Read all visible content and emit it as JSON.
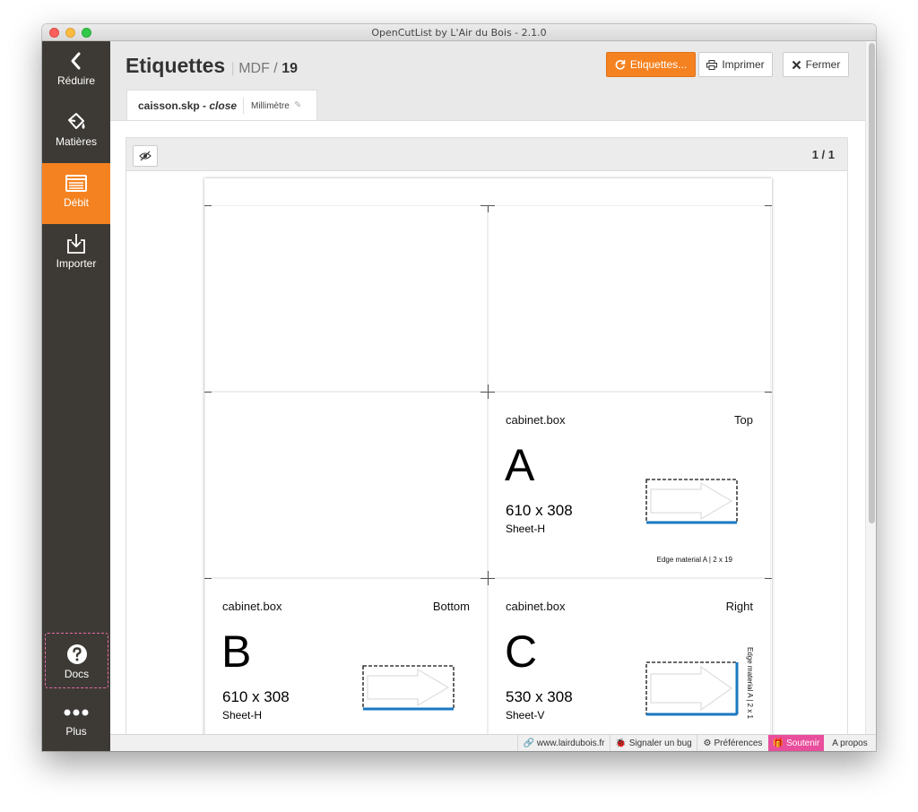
{
  "window": {
    "title": "OpenCutList by L'Air du Bois - 2.1.0"
  },
  "sidebar": {
    "items": [
      {
        "label": "Réduire",
        "icon": "chevron-left-icon"
      },
      {
        "label": "Matières",
        "icon": "paint-bucket-icon"
      },
      {
        "label": "Débit",
        "icon": "list-icon",
        "active": true
      },
      {
        "label": "Importer",
        "icon": "import-icon"
      }
    ],
    "docs": {
      "label": "Docs",
      "icon": "question-circle-icon"
    },
    "plus": {
      "label": "Plus",
      "icon": "ellipsis-icon"
    },
    "colors": {
      "background": "#3d3a35",
      "active": "#f58220"
    }
  },
  "header": {
    "title": "Etiquettes",
    "material": "MDF",
    "slash": "/",
    "thickness": "19",
    "buttons": {
      "refresh": "Etiquettes...",
      "print": "Imprimer",
      "close": "Fermer"
    }
  },
  "file_tab": {
    "filename": "caisson.skp",
    "dash": " - ",
    "action": "close",
    "unit": "Millimètre"
  },
  "preview": {
    "page": "1 / 1",
    "labels": [
      {
        "entity": "cabinet.box",
        "face": "Top",
        "letter": "A",
        "dims": "610 x 308",
        "sheet": "Sheet-H",
        "edge": "Edge material A | 2 x 19"
      },
      {
        "entity": "cabinet.box",
        "face": "Bottom",
        "letter": "B",
        "dims": "610 x 308",
        "sheet": "Sheet-H"
      },
      {
        "entity": "cabinet.box",
        "face": "Right",
        "letter": "C",
        "dims": "530 x 308",
        "sheet": "Sheet-V",
        "edge_vertical": "Edge material A | 2 x 1"
      }
    ]
  },
  "statusbar": {
    "website": "www.lairdubois.fr",
    "bug": "Signaler un bug",
    "prefs": "Préférences",
    "support": "Soutenir",
    "about": "A propos"
  },
  "colors": {
    "accent": "#f58220",
    "support": "#e84e9c",
    "edge_band": "#1a78c2"
  }
}
